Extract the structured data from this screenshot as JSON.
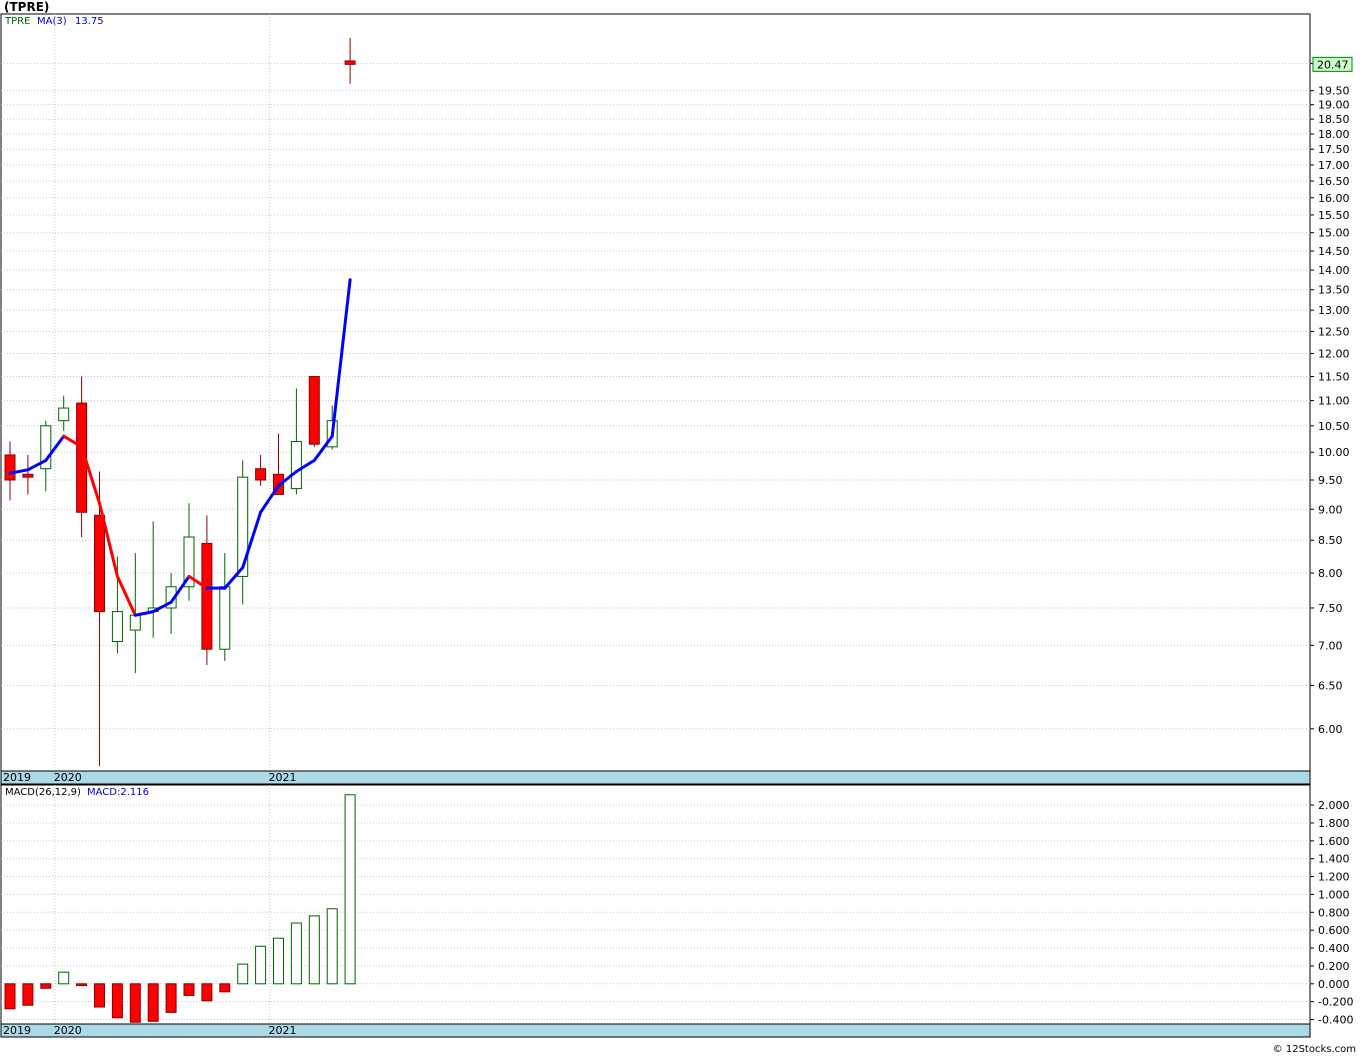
{
  "title": "(TPRE)",
  "footer": "© 12Stocks.com",
  "colors": {
    "up": "#006400",
    "down": "#ff0000",
    "ma_up": "#0000ff",
    "ma_down": "#ff0000",
    "axis_band": "#add8e6",
    "grid": "#c8c8c8",
    "last_price_bg": "#ccffcc"
  },
  "chart_data": [
    {
      "type": "candlestick",
      "legend": {
        "symbol": "TPRE",
        "ma_label": "MA(3)",
        "ma_value": "13.75"
      },
      "last_price": "20.47",
      "ylim": [
        5.55,
        22.3
      ],
      "y_scale": "log",
      "y_ticks": [
        "6.00",
        "6.50",
        "7.00",
        "7.50",
        "8.00",
        "8.50",
        "9.00",
        "9.50",
        "10.00",
        "10.50",
        "11.00",
        "11.50",
        "12.00",
        "12.50",
        "13.00",
        "13.50",
        "14.00",
        "14.50",
        "15.00",
        "15.50",
        "16.00",
        "16.50",
        "17.00",
        "17.50",
        "18.00",
        "18.50",
        "19.00",
        "19.50",
        "20.50"
      ],
      "x_labels": [
        {
          "label": "2019",
          "index": 0
        },
        {
          "label": "2020",
          "index": 3
        },
        {
          "label": "2021",
          "index": 15
        }
      ],
      "candles": [
        {
          "o": 9.95,
          "h": 10.2,
          "l": 9.15,
          "c": 9.5
        },
        {
          "o": 9.6,
          "h": 9.95,
          "l": 9.25,
          "c": 9.55
        },
        {
          "o": 9.7,
          "h": 10.6,
          "l": 9.3,
          "c": 10.5
        },
        {
          "o": 10.6,
          "h": 11.1,
          "l": 10.4,
          "c": 10.85
        },
        {
          "o": 10.95,
          "h": 11.5,
          "l": 8.55,
          "c": 8.95
        },
        {
          "o": 8.9,
          "h": 9.65,
          "l": 5.6,
          "c": 7.45
        },
        {
          "o": 7.05,
          "h": 8.25,
          "l": 6.9,
          "c": 7.45
        },
        {
          "o": 7.2,
          "h": 8.3,
          "l": 6.65,
          "c": 7.4
        },
        {
          "o": 7.45,
          "h": 8.8,
          "l": 7.1,
          "c": 7.5
        },
        {
          "o": 7.5,
          "h": 8.0,
          "l": 7.15,
          "c": 7.8
        },
        {
          "o": 7.8,
          "h": 9.1,
          "l": 7.6,
          "c": 8.55
        },
        {
          "o": 8.45,
          "h": 8.9,
          "l": 6.75,
          "c": 6.95
        },
        {
          "o": 6.95,
          "h": 8.3,
          "l": 6.8,
          "c": 7.8
        },
        {
          "o": 7.95,
          "h": 9.85,
          "l": 7.55,
          "c": 9.55
        },
        {
          "o": 9.7,
          "h": 9.95,
          "l": 9.4,
          "c": 9.5
        },
        {
          "o": 9.6,
          "h": 10.35,
          "l": 9.25,
          "c": 9.25
        },
        {
          "o": 9.35,
          "h": 11.25,
          "l": 9.25,
          "c": 10.2
        },
        {
          "o": 11.5,
          "h": 11.5,
          "l": 10.1,
          "c": 10.15
        },
        {
          "o": 10.1,
          "h": 10.9,
          "l": 10.05,
          "c": 10.6
        },
        {
          "o": 20.6,
          "h": 21.5,
          "l": 19.75,
          "c": 20.47
        }
      ],
      "ma": [
        9.62,
        9.68,
        9.85,
        10.3,
        10.1,
        9.1,
        7.95,
        7.4,
        7.45,
        7.58,
        7.95,
        7.78,
        7.78,
        8.08,
        8.95,
        9.4,
        9.65,
        9.85,
        10.3,
        13.75
      ]
    },
    {
      "type": "bar",
      "legend": {
        "label": "MACD(26,12,9)",
        "value_label": "MACD:2.116"
      },
      "ylim": [
        -0.45,
        2.18
      ],
      "y_ticks": [
        "-0.400",
        "-0.200",
        "0.000",
        "0.200",
        "0.400",
        "0.600",
        "0.800",
        "1.000",
        "1.200",
        "1.400",
        "1.600",
        "1.800",
        "2.000"
      ],
      "x_labels": [
        {
          "label": "2019",
          "index": 0
        },
        {
          "label": "2020",
          "index": 3
        },
        {
          "label": "2021",
          "index": 15
        }
      ],
      "values": [
        -0.28,
        -0.24,
        -0.05,
        0.13,
        -0.02,
        -0.26,
        -0.38,
        -0.43,
        -0.42,
        -0.32,
        -0.13,
        -0.19,
        -0.09,
        0.22,
        0.42,
        0.51,
        0.68,
        0.76,
        0.84,
        2.116
      ]
    }
  ]
}
